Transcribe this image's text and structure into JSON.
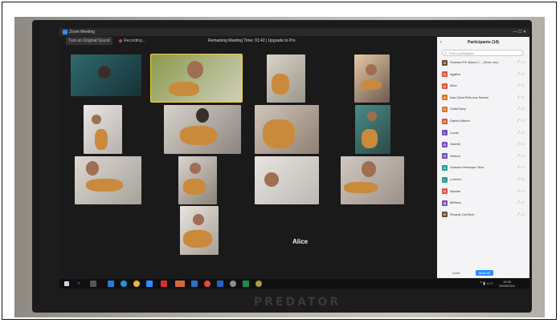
{
  "zoom": {
    "window_title": "Zoom Meeting",
    "original_sound": "Turn on Original Sound",
    "recording": "Recording...",
    "remaining_time": "Remaining Meeting Time: 01:42 | Upgrade to Pro",
    "alice_label": "Alice"
  },
  "participants": {
    "header": "Participants (14)",
    "search_placeholder": "Find a participant",
    "items": [
      {
        "name": "Gustavo Pe Vasco C... (Host, me)",
        "color": "#6b4f3a"
      },
      {
        "name": "Agatha",
        "color": "#e2563f"
      },
      {
        "name": "Alice",
        "color": "#e2563f"
      },
      {
        "name": "Ana Clara Reis dos Santos",
        "color": "#d77a2a"
      },
      {
        "name": "CriskChary",
        "color": "#d77a2a"
      },
      {
        "name": "Daniel Alberto",
        "color": "#e2563f"
      },
      {
        "name": "Lucas",
        "color": "#7a4fbd"
      },
      {
        "name": "Gabriel",
        "color": "#7a4fbd"
      },
      {
        "name": "Helena",
        "color": "#7a4fbd"
      },
      {
        "name": "Gustavo Henrique Olive",
        "color": "#2a9d8f"
      },
      {
        "name": "Lorenzo",
        "color": "#2a9d8f"
      },
      {
        "name": "Nicolas",
        "color": "#e2563f"
      },
      {
        "name": "Melissa",
        "color": "#7a4fbd"
      },
      {
        "name": "Ricardo Cal Bern",
        "color": "#6b4f3a"
      }
    ],
    "invite_label": "Invite",
    "mute_all_label": "Mute All",
    "more_label": "..."
  },
  "taskbar": {
    "time": "19:30",
    "date": "25/05/2021"
  },
  "monitor_brand": "PREDATOR"
}
